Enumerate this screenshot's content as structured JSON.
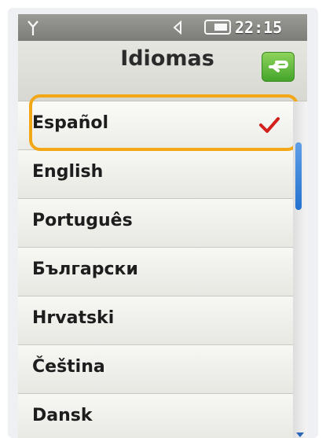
{
  "status": {
    "time": "22:15",
    "icons": [
      "signal-icon",
      "sound-icon",
      "battery-icon"
    ]
  },
  "header": {
    "title": "Idiomas",
    "back_icon": "back-arrow-icon"
  },
  "languages": [
    {
      "label": "Español",
      "selected": true
    },
    {
      "label": "English",
      "selected": false
    },
    {
      "label": "Português",
      "selected": false
    },
    {
      "label": "Български",
      "selected": false
    },
    {
      "label": "Hrvatski",
      "selected": false
    },
    {
      "label": "Čeština",
      "selected": false
    },
    {
      "label": "Dansk",
      "selected": false
    }
  ],
  "colors": {
    "highlight": "#f2a816",
    "check": "#d2201c",
    "back_button": "#56b334",
    "scroll_thumb": "#2f79d6"
  }
}
